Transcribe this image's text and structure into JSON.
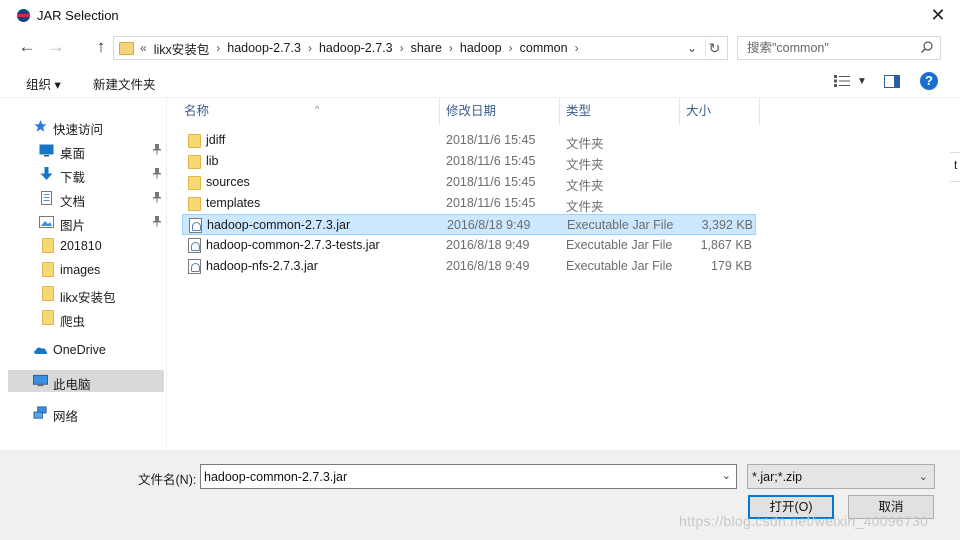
{
  "window": {
    "title": "JAR Selection",
    "close_glyph": "✕"
  },
  "nav": {
    "back_glyph": "←",
    "forward_glyph": "→",
    "up_glyph": "↑",
    "breadcrumb": [
      "likx安装包",
      "hadoop-2.7.3",
      "hadoop-2.7.3",
      "share",
      "hadoop",
      "common"
    ],
    "overflow": "«",
    "separator": "›",
    "search_placeholder": "搜索\"common\""
  },
  "toolbar": {
    "organize": "组织 ▾",
    "new_folder": "新建文件夹"
  },
  "sidebar": {
    "items": [
      {
        "label": "快速访问",
        "icon": "star-icon"
      },
      {
        "label": "桌面",
        "icon": "desktop-icon",
        "pinned": true
      },
      {
        "label": "下载",
        "icon": "download-icon",
        "pinned": true
      },
      {
        "label": "文档",
        "icon": "document-icon",
        "pinned": true
      },
      {
        "label": "图片",
        "icon": "pictures-icon",
        "pinned": true
      },
      {
        "label": "201810",
        "icon": "folder-icon"
      },
      {
        "label": "images",
        "icon": "folder-icon"
      },
      {
        "label": "likx安装包",
        "icon": "folder-icon"
      },
      {
        "label": "爬虫",
        "icon": "folder-icon"
      },
      {
        "label": "OneDrive",
        "icon": "cloud-icon"
      },
      {
        "label": "此电脑",
        "icon": "computer-icon",
        "selected": true
      },
      {
        "label": "网络",
        "icon": "network-icon"
      }
    ]
  },
  "columns": {
    "name": "名称",
    "date": "修改日期",
    "type": "类型",
    "size": "大小"
  },
  "files": [
    {
      "name": "jdiff",
      "date": "2018/11/6 15:45",
      "type": "文件夹",
      "size": "",
      "kind": "folder"
    },
    {
      "name": "lib",
      "date": "2018/11/6 15:45",
      "type": "文件夹",
      "size": "",
      "kind": "folder"
    },
    {
      "name": "sources",
      "date": "2018/11/6 15:45",
      "type": "文件夹",
      "size": "",
      "kind": "folder"
    },
    {
      "name": "templates",
      "date": "2018/11/6 15:45",
      "type": "文件夹",
      "size": "",
      "kind": "folder"
    },
    {
      "name": "hadoop-common-2.7.3.jar",
      "date": "2016/8/18 9:49",
      "type": "Executable Jar File",
      "size": "3,392 KB",
      "kind": "jar",
      "selected": true
    },
    {
      "name": "hadoop-common-2.7.3-tests.jar",
      "date": "2016/8/18 9:49",
      "type": "Executable Jar File",
      "size": "1,867 KB",
      "kind": "jar"
    },
    {
      "name": "hadoop-nfs-2.7.3.jar",
      "date": "2016/8/18 9:49",
      "type": "Executable Jar File",
      "size": "179 KB",
      "kind": "jar"
    }
  ],
  "bottom": {
    "filename_label": "文件名(N):",
    "filename_value": "hadoop-common-2.7.3.jar",
    "filter": "*.jar;*.zip",
    "open": "打开(O)",
    "cancel": "取消",
    "watermark": "https://blog.csdn.net/weixin_40096730"
  },
  "edge_char": "t"
}
